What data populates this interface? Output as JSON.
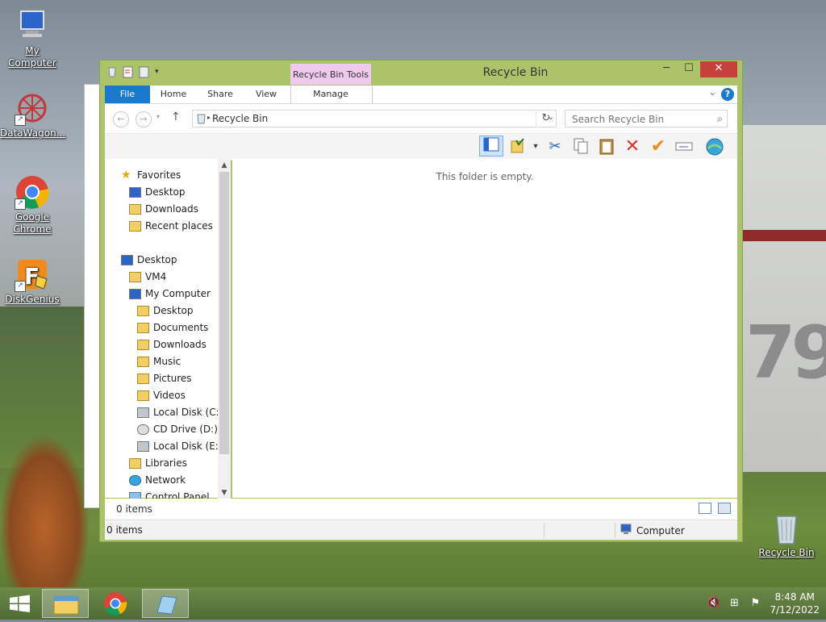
{
  "desktop": {
    "icons": [
      {
        "label": "My Computer"
      },
      {
        "label": "DataWagon..."
      },
      {
        "label": "Google Chrome"
      },
      {
        "label": "DiskGenius"
      },
      {
        "label": "Recycle Bin"
      }
    ],
    "wall_digits": "79"
  },
  "window": {
    "title": "Recycle Bin",
    "context_tab_group": "Recycle Bin Tools",
    "controls": {
      "minimize": "─",
      "maximize": "☐",
      "close": "✕"
    },
    "ribbon_tabs": [
      "File",
      "Home",
      "Share",
      "View",
      "Manage"
    ],
    "help": "?",
    "address": {
      "crumb": "Recycle Bin"
    },
    "search": {
      "placeholder": "Search Recycle Bin"
    },
    "empty_message": "This folder is empty.",
    "item_count_top": "0 items",
    "item_count_status": "0 items",
    "status_zone": "Computer"
  },
  "nav": {
    "items": [
      {
        "label": "Favorites",
        "icon": "star-icon"
      },
      {
        "label": "Desktop",
        "icon": "desktop-icon"
      },
      {
        "label": "Downloads",
        "icon": "downloads-icon"
      },
      {
        "label": "Recent places",
        "icon": "recent-icon"
      },
      {
        "label": "Desktop",
        "icon": "desktop-icon"
      },
      {
        "label": "VM4",
        "icon": "user-folder-icon"
      },
      {
        "label": "My Computer",
        "icon": "computer-icon"
      },
      {
        "label": "Desktop",
        "icon": "folder-icon"
      },
      {
        "label": "Documents",
        "icon": "folder-icon"
      },
      {
        "label": "Downloads",
        "icon": "downloads-icon"
      },
      {
        "label": "Music",
        "icon": "music-icon"
      },
      {
        "label": "Pictures",
        "icon": "pictures-icon"
      },
      {
        "label": "Videos",
        "icon": "videos-icon"
      },
      {
        "label": "Local Disk (C:)",
        "icon": "drive-icon"
      },
      {
        "label": "CD Drive (D:)",
        "icon": "cd-icon"
      },
      {
        "label": "Local Disk (E:)",
        "icon": "drive-icon"
      },
      {
        "label": "Libraries",
        "icon": "libraries-icon"
      },
      {
        "label": "Network",
        "icon": "network-icon"
      },
      {
        "label": "Control Panel",
        "icon": "control-panel-icon"
      }
    ]
  },
  "taskbar": {
    "time": "8:48 AM",
    "date": "7/12/2022"
  },
  "colors": {
    "window_frame": "#abc46a",
    "file_tab": "#1979ca",
    "context_tab": "#f0c9ee",
    "close_button": "#c7413a"
  }
}
